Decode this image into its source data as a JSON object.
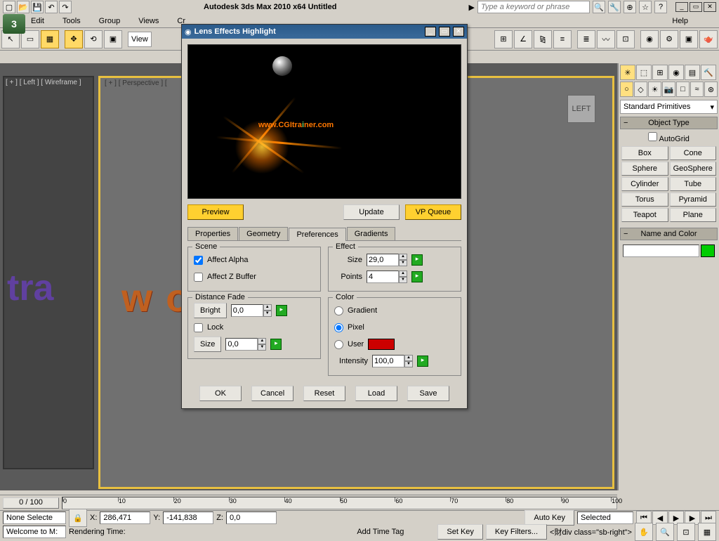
{
  "titlebar": {
    "app_title": "Autodesk 3ds Max  2010 x64      Untitled",
    "search_placeholder": "Type a keyword or phrase"
  },
  "menus": [
    "Edit",
    "Tools",
    "Group",
    "Views",
    "Cr",
    "",
    "",
    "",
    "",
    "",
    "",
    "",
    "",
    "",
    "",
    "",
    "",
    "",
    "",
    "Help"
  ],
  "main_toolbar": {
    "view_dropdown": "View"
  },
  "viewports": {
    "left_label": "[ + ] [ Left ] [ Wireframe ]",
    "persp_label": "[ + ] [ Perspective ] [",
    "text3d_right": "w                                           om",
    "text3d_left": "tra",
    "viewcube": "LEFT"
  },
  "cmd_panel": {
    "category": "Standard Primitives",
    "rollout_type": "Object Type",
    "autogrid": "AutoGrid",
    "prims": [
      "Box",
      "Cone",
      "Sphere",
      "GeoSphere",
      "Cylinder",
      "Tube",
      "Torus",
      "Pyramid",
      "Teapot",
      "Plane"
    ],
    "rollout_name": "Name and Color"
  },
  "timeline": {
    "slider": "0 / 100",
    "ticks": [
      0,
      10,
      20,
      30,
      40,
      50,
      60,
      70,
      80,
      90,
      100
    ]
  },
  "status": {
    "welcome": "Welcome to M:",
    "selection": "None Selecte",
    "x": "286,471",
    "y": "-141,838",
    "z": "0,0",
    "render_time": "Rendering Time:",
    "add_time_tag": "Add Time Tag",
    "auto_key": "Auto Key",
    "set_key": "Set Key",
    "key_sel": "Selected",
    "key_filters": "Key Filters..."
  },
  "dialog": {
    "title": "Lens Effects Highlight",
    "preview_text_1": "www.",
    "preview_text_2": "CGItra",
    "preview_text_2b": "i",
    "preview_text_3": "ner.com",
    "btn_preview": "Preview",
    "btn_update": "Update",
    "btn_vp": "VP Queue",
    "tabs": [
      "Properties",
      "Geometry",
      "Preferences",
      "Gradients"
    ],
    "scene": {
      "title": "Scene",
      "affect_alpha": "Affect Alpha",
      "affect_z": "Affect Z Buffer"
    },
    "distance_fade": {
      "title": "Distance Fade",
      "bright": "Bright",
      "bright_val": "0,0",
      "lock": "Lock",
      "size": "Size",
      "size_val": "0,0"
    },
    "effect": {
      "title": "Effect",
      "size": "Size",
      "size_val": "29,0",
      "points": "Points",
      "points_val": "4"
    },
    "color": {
      "title": "Color",
      "gradient": "Gradient",
      "pixel": "Pixel",
      "user": "User",
      "intensity": "Intensity",
      "intensity_val": "100,0"
    },
    "bottom": [
      "OK",
      "Cancel",
      "Reset",
      "Load",
      "Save"
    ]
  }
}
